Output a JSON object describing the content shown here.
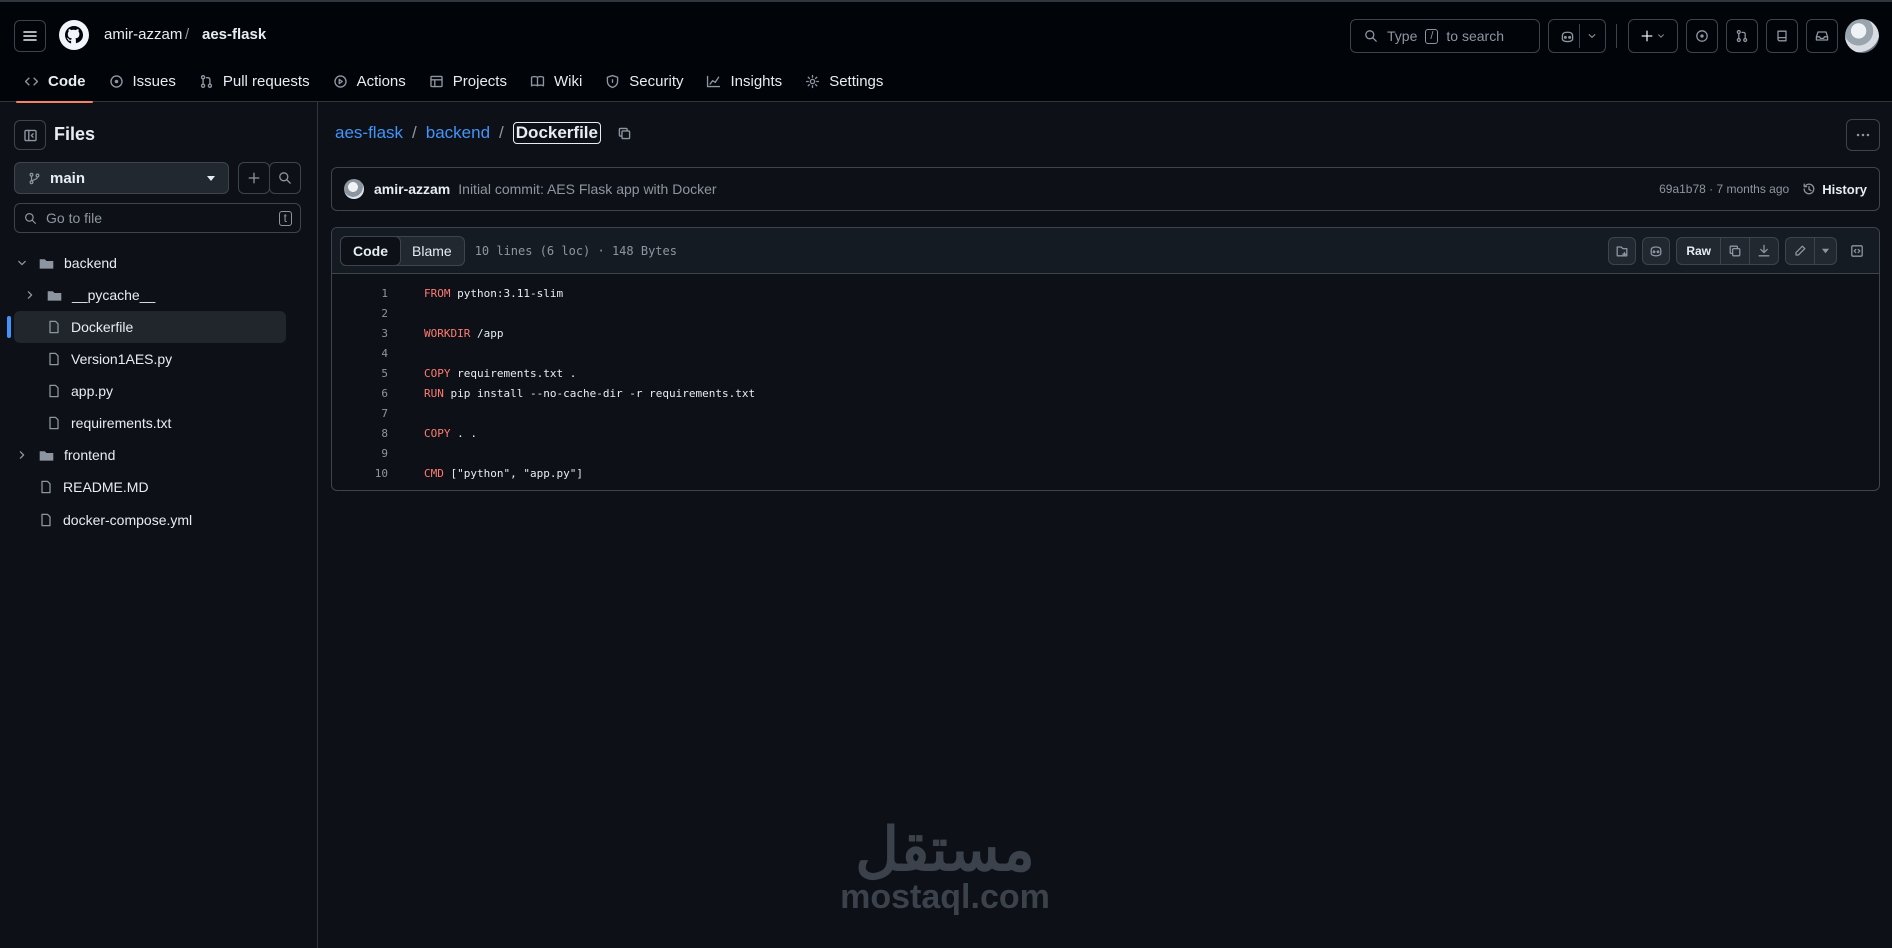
{
  "header": {
    "owner": "amir-azzam",
    "separator": "/",
    "repo": "aes-flask",
    "search_prefix": "Type",
    "search_key": "/",
    "search_suffix": "to search"
  },
  "tabs": [
    {
      "label": "Code",
      "icon": "code-icon"
    },
    {
      "label": "Issues",
      "icon": "issue-icon"
    },
    {
      "label": "Pull requests",
      "icon": "pull-request-icon"
    },
    {
      "label": "Actions",
      "icon": "play-icon"
    },
    {
      "label": "Projects",
      "icon": "table-icon"
    },
    {
      "label": "Wiki",
      "icon": "book-icon"
    },
    {
      "label": "Security",
      "icon": "shield-icon"
    },
    {
      "label": "Insights",
      "icon": "graph-icon"
    },
    {
      "label": "Settings",
      "icon": "gear-icon"
    }
  ],
  "sidebar": {
    "title": "Files",
    "branch": "main",
    "goto_placeholder": "Go to file",
    "goto_key": "t",
    "tree": [
      {
        "name": "backend",
        "type": "folder",
        "expanded": true
      },
      {
        "name": "__pycache__",
        "type": "folder",
        "expanded": false
      },
      {
        "name": "Dockerfile",
        "type": "file",
        "selected": true
      },
      {
        "name": "Version1AES.py",
        "type": "file"
      },
      {
        "name": "app.py",
        "type": "file"
      },
      {
        "name": "requirements.txt",
        "type": "file"
      },
      {
        "name": "frontend",
        "type": "folder",
        "expanded": false
      },
      {
        "name": "README.MD",
        "type": "file"
      },
      {
        "name": "docker-compose.yml",
        "type": "file"
      }
    ]
  },
  "path": {
    "repo": "aes-flask",
    "dir": "backend",
    "file": "Dockerfile",
    "sep": "/"
  },
  "commit": {
    "author": "amir-azzam",
    "message": "Initial commit: AES Flask app with Docker",
    "meta": "69a1b78 · 7 months ago",
    "history_label": "History"
  },
  "file": {
    "view_code": "Code",
    "view_blame": "Blame",
    "info": "10 lines (6 loc) · 148 Bytes",
    "raw_label": "Raw",
    "lines": [
      {
        "n": "1",
        "kw": "FROM",
        "rest": " python:3.11-slim"
      },
      {
        "n": "2",
        "kw": "",
        "rest": ""
      },
      {
        "n": "3",
        "kw": "WORKDIR",
        "rest": " /app"
      },
      {
        "n": "4",
        "kw": "",
        "rest": ""
      },
      {
        "n": "5",
        "kw": "COPY",
        "rest": " requirements.txt ."
      },
      {
        "n": "6",
        "kw": "RUN",
        "rest": " pip install --no-cache-dir -r requirements.txt"
      },
      {
        "n": "7",
        "kw": "",
        "rest": ""
      },
      {
        "n": "8",
        "kw": "COPY",
        "rest": " . ."
      },
      {
        "n": "9",
        "kw": "",
        "rest": ""
      },
      {
        "n": "10",
        "kw": "CMD",
        "rest": " [\"python\", \"app.py\"]"
      }
    ]
  },
  "watermark": {
    "arabic": "مستقل",
    "latin": "mostaql.com"
  },
  "colors": {
    "background": "#0d1117",
    "header_bg": "#010409",
    "accent_tab": "#f78166",
    "link": "#4493f8",
    "keyword": "#ff7b72"
  }
}
